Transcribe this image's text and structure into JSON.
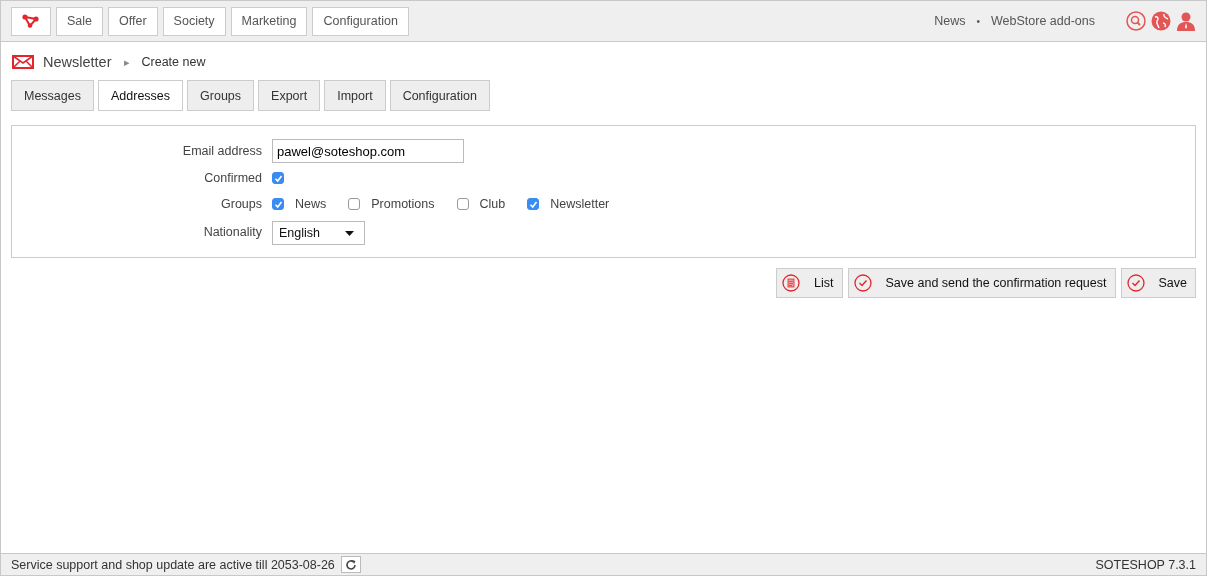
{
  "top_nav": {
    "items": [
      "Sale",
      "Offer",
      "Society",
      "Marketing",
      "Configuration"
    ],
    "links": [
      "News",
      "WebStore add-ons"
    ],
    "separator": "•"
  },
  "breadcrumb": {
    "title": "Newsletter",
    "arrow": "▸",
    "current": "Create new"
  },
  "tabs": [
    {
      "label": "Messages",
      "selected": false
    },
    {
      "label": "Addresses",
      "selected": true
    },
    {
      "label": "Groups",
      "selected": false
    },
    {
      "label": "Export",
      "selected": false
    },
    {
      "label": "Import",
      "selected": false
    },
    {
      "label": "Configuration",
      "selected": false
    }
  ],
  "form": {
    "email": {
      "label": "Email address",
      "value": "pawel@soteshop.com"
    },
    "confirmed": {
      "label": "Confirmed",
      "checked": true
    },
    "groups": {
      "label": "Groups",
      "options": [
        {
          "label": "News",
          "checked": true
        },
        {
          "label": "Promotions",
          "checked": false
        },
        {
          "label": "Club",
          "checked": false
        },
        {
          "label": "Newsletter",
          "checked": true
        }
      ]
    },
    "nationality": {
      "label": "Nationality",
      "value": "English"
    }
  },
  "actions": [
    {
      "label": "List",
      "kind": "list"
    },
    {
      "label": "Save and send the confirmation request",
      "kind": "check"
    },
    {
      "label": "Save",
      "kind": "check"
    }
  ],
  "status_bar": {
    "text": "Service support and shop update are active till 2053-08-26",
    "version": "SOTESHOP 7.3.1"
  }
}
